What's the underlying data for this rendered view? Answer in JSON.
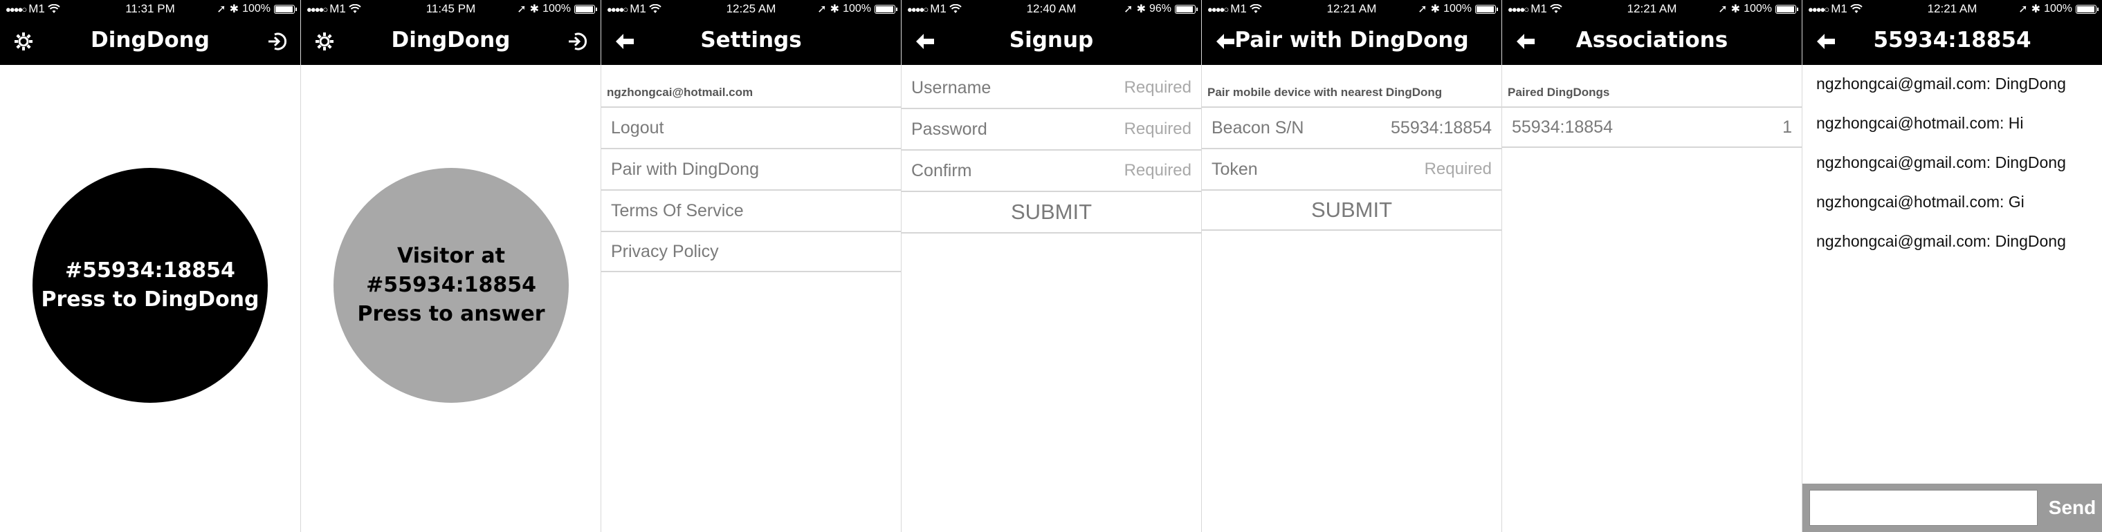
{
  "colors": {
    "nav_bg": "#000000",
    "circle_active": "#000000",
    "circle_visitor": "#a8a8a8",
    "text_grey": "#7a7a7a"
  },
  "screens": [
    {
      "status": {
        "carrier": "M1",
        "time": "11:31 PM",
        "battery": "100%",
        "battery_fill": 1.0
      },
      "title": "DingDong",
      "left_icon": "gear-icon",
      "right_icon": "logout-icon",
      "button": {
        "line1": "#55934:18854",
        "line2": "Press to DingDong"
      }
    },
    {
      "status": {
        "carrier": "M1",
        "time": "11:45 PM",
        "battery": "100%",
        "battery_fill": 1.0
      },
      "title": "DingDong",
      "left_icon": "gear-icon",
      "right_icon": "logout-icon",
      "button": {
        "line1": "Visitor at",
        "line2": "#55934:18854",
        "line3": "Press to answer"
      }
    },
    {
      "status": {
        "carrier": "M1",
        "time": "12:25 AM",
        "battery": "100%",
        "battery_fill": 1.0
      },
      "title": "Settings",
      "left_icon": "back-arrow-icon",
      "section": "ngzhongcai@hotmail.com",
      "rows": [
        "Logout",
        "Pair with DingDong",
        "Terms Of Service",
        "Privacy Policy"
      ]
    },
    {
      "status": {
        "carrier": "M1",
        "time": "12:40 AM",
        "battery": "96%",
        "battery_fill": 0.96
      },
      "title": "Signup",
      "left_icon": "back-arrow-icon",
      "fields": [
        {
          "label": "Username",
          "placeholder": "Required"
        },
        {
          "label": "Password",
          "placeholder": "Required"
        },
        {
          "label": "Confirm",
          "placeholder": "Required"
        }
      ],
      "submit": "SUBMIT"
    },
    {
      "status": {
        "carrier": "M1",
        "time": "12:21 AM",
        "battery": "100%",
        "battery_fill": 1.0
      },
      "title": "Pair with DingDong",
      "left_icon": "back-arrow-icon",
      "section": "Pair mobile device with nearest DingDong",
      "fields": [
        {
          "label": "Beacon S/N",
          "value": "55934:18854"
        },
        {
          "label": "Token",
          "placeholder": "Required"
        }
      ],
      "submit": "SUBMIT"
    },
    {
      "status": {
        "carrier": "M1",
        "time": "12:21 AM",
        "battery": "100%",
        "battery_fill": 1.0
      },
      "title": "Associations",
      "left_icon": "back-arrow-icon",
      "section": "Paired DingDongs",
      "rows": [
        {
          "label": "55934:18854",
          "value": "1"
        }
      ]
    },
    {
      "status": {
        "carrier": "M1",
        "time": "12:21 AM",
        "battery": "100%",
        "battery_fill": 1.0
      },
      "title": "55934:18854",
      "left_icon": "back-arrow-icon",
      "messages": [
        "ngzhongcai@gmail.com: DingDong",
        "ngzhongcai@hotmail.com: Hi",
        "ngzhongcai@gmail.com: DingDong",
        "ngzhongcai@hotmail.com: Gi",
        "ngzhongcai@gmail.com: DingDong"
      ],
      "send_label": "Send"
    }
  ]
}
